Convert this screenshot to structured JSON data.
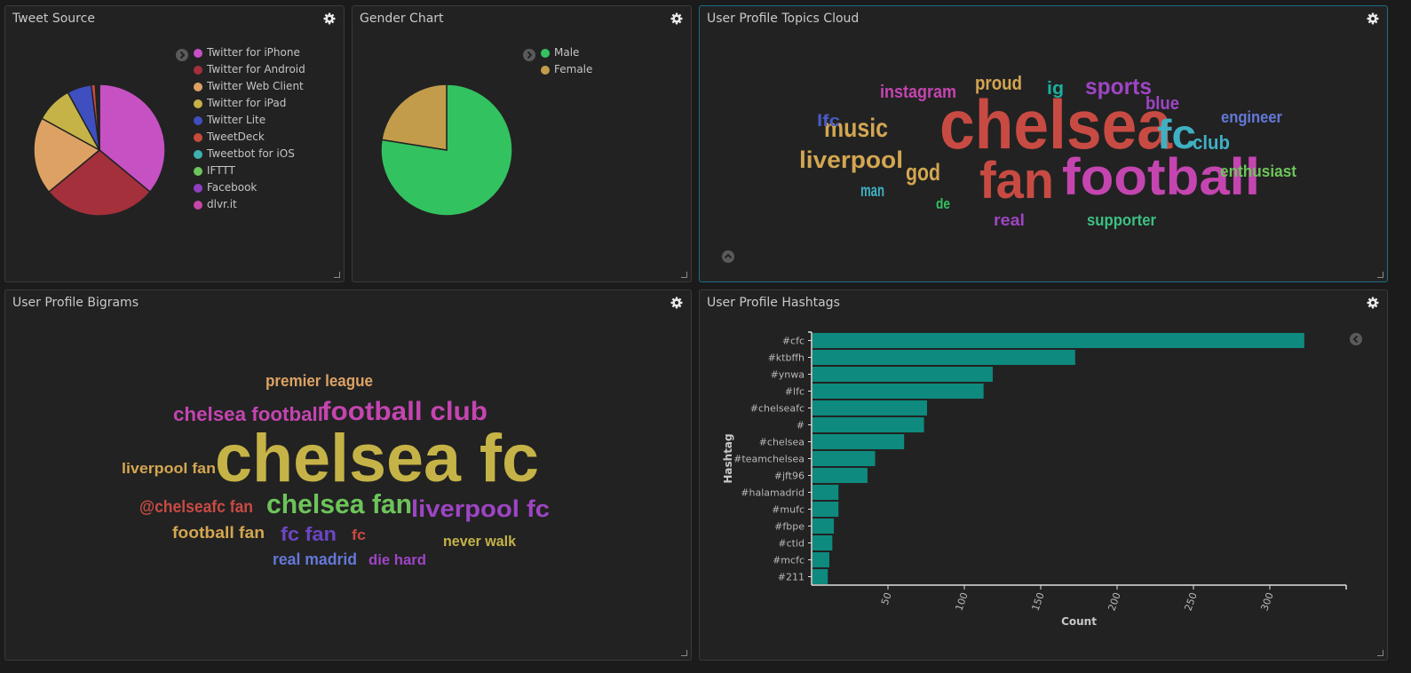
{
  "colors": {
    "background": "#1b1b1b",
    "panel": "#222222",
    "panel_border": "#3a3a3a",
    "active_border": "#1d6f86",
    "bar": "#0e8a7f"
  },
  "panels": {
    "tweet_source": {
      "title": "Tweet Source",
      "chart_data": {
        "type": "pie",
        "labels": [
          "Twitter for iPhone",
          "Twitter for Android",
          "Twitter Web Client",
          "Twitter for iPad",
          "Twitter Lite",
          "TweetDeck",
          "Tweetbot for iOS",
          "IFTTT",
          "Facebook",
          "dlvr.it"
        ],
        "values": [
          36,
          28,
          19,
          9,
          6,
          1,
          0.3,
          0.3,
          0.2,
          0.2
        ],
        "colors": [
          "#c651c3",
          "#a3303b",
          "#dda263",
          "#c5b347",
          "#3f4fbf",
          "#c84b3b",
          "#3fb1b1",
          "#6dc45a",
          "#8e3fc2",
          "#c846a6"
        ],
        "legend": "top-right"
      }
    },
    "gender_chart": {
      "title": "Gender Chart",
      "chart_data": {
        "type": "pie",
        "labels": [
          "Male",
          "Female"
        ],
        "values": [
          77.5,
          22.5
        ],
        "colors": [
          "#33c260",
          "#c29c4b"
        ],
        "legend": "top-right"
      }
    },
    "topics_cloud": {
      "title": "User Profile Topics Cloud",
      "words": [
        {
          "text": "chelsea",
          "color": "#c84b43"
        },
        {
          "text": "football",
          "color": "#c445b0"
        },
        {
          "text": "fan",
          "color": "#c84b43"
        },
        {
          "text": "fc",
          "color": "#3fb0c4"
        },
        {
          "text": "music",
          "color": "#d3a651"
        },
        {
          "text": "liverpool",
          "color": "#d3a651"
        },
        {
          "text": "god",
          "color": "#d3a651"
        },
        {
          "text": "instagram",
          "color": "#c445b0"
        },
        {
          "text": "proud",
          "color": "#d3a651"
        },
        {
          "text": "sports",
          "color": "#9e45c4"
        },
        {
          "text": "ig",
          "color": "#1ab0a0"
        },
        {
          "text": "blue",
          "color": "#9e45c4"
        },
        {
          "text": "club",
          "color": "#3fb0c4"
        },
        {
          "text": "engineer",
          "color": "#6478d8"
        },
        {
          "text": "enthusiast",
          "color": "#6dc45a"
        },
        {
          "text": "supporter",
          "color": "#3dc080"
        },
        {
          "text": "real",
          "color": "#9e45c4"
        },
        {
          "text": "lfc",
          "color": "#4a5cc8"
        },
        {
          "text": "man",
          "color": "#3fb0c4"
        },
        {
          "text": "de",
          "color": "#33c260"
        }
      ]
    },
    "bigrams": {
      "title": "User Profile Bigrams",
      "words": [
        {
          "text": "chelsea fc",
          "color": "#c5b347"
        },
        {
          "text": "football club",
          "color": "#c445b0"
        },
        {
          "text": "chelsea football",
          "color": "#c445b0"
        },
        {
          "text": "premier league",
          "color": "#dda263"
        },
        {
          "text": "liverpool fan",
          "color": "#d3a651"
        },
        {
          "text": "chelsea fan",
          "color": "#6dc45a"
        },
        {
          "text": "liverpool fc",
          "color": "#9e45c4"
        },
        {
          "text": "@chelseafc fan",
          "color": "#c84b43"
        },
        {
          "text": "football fan",
          "color": "#d3a651"
        },
        {
          "text": "fc fan",
          "color": "#6c45c4"
        },
        {
          "text": "fc",
          "color": "#c84b43"
        },
        {
          "text": "never walk",
          "color": "#c5b347"
        },
        {
          "text": "real madrid",
          "color": "#6478d8"
        },
        {
          "text": "die hard",
          "color": "#9e45c4"
        }
      ]
    },
    "hashtags": {
      "title": "User Profile Hashtags",
      "chart_data": {
        "type": "bar",
        "orientation": "horizontal",
        "categories": [
          "#cfc",
          "#ktbffh",
          "#ynwa",
          "#lfc",
          "#chelseafc",
          "#",
          "#chelsea",
          "#teamchelsea",
          "#jft96",
          "#halamadrid",
          "#mufc",
          "#fbpe",
          "#ctid",
          "#mcfc",
          "#211"
        ],
        "values": [
          322,
          172,
          118,
          112,
          75,
          73,
          60,
          41,
          36,
          17,
          17,
          14,
          13,
          11,
          10
        ],
        "xlabel": "Count",
        "ylabel": "Hashtag",
        "xticks": [
          50,
          100,
          150,
          200,
          250,
          300
        ],
        "xlim": [
          0,
          350
        ],
        "grid": false
      }
    }
  }
}
